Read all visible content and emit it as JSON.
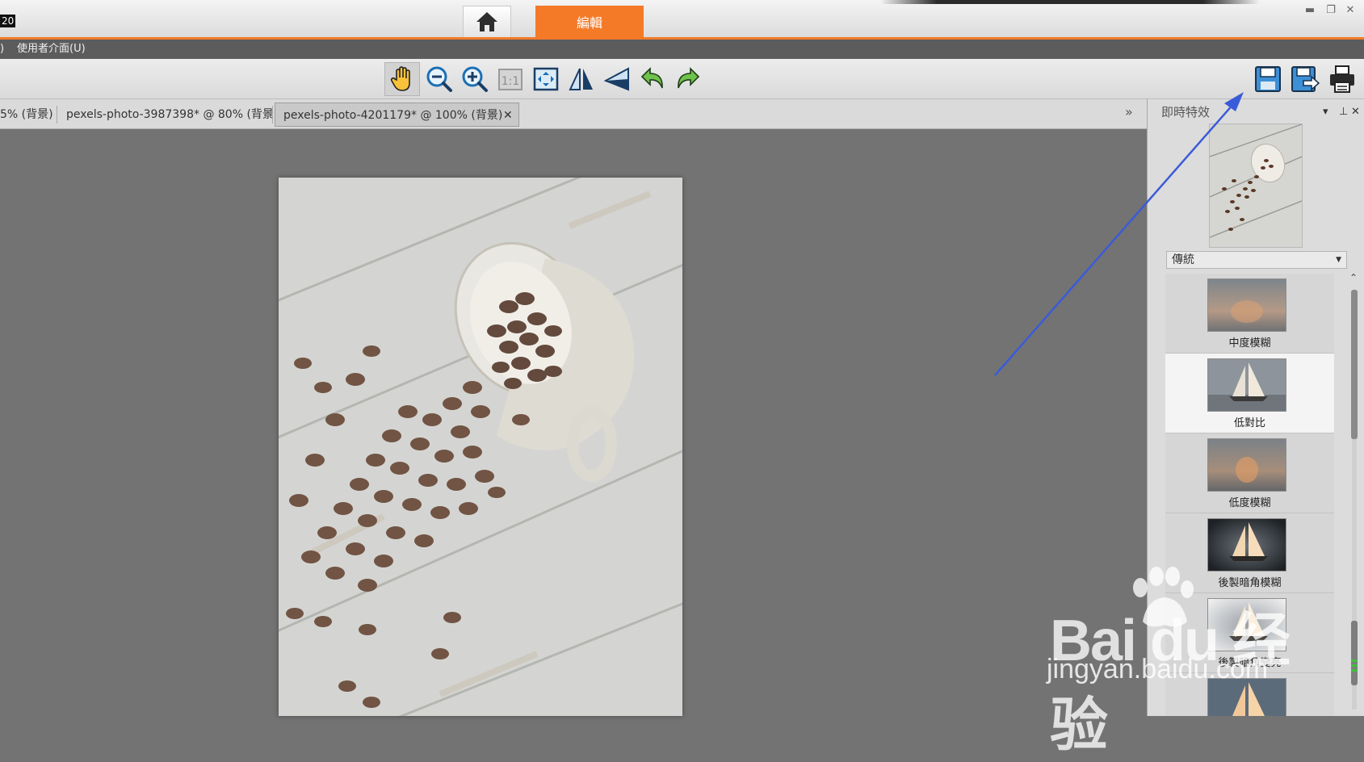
{
  "titlebar": {
    "version_badge": "20",
    "edit_tab_label": "編輯",
    "home_icon": "home-icon",
    "window_controls": [
      "minimize-icon",
      "restore-icon",
      "close-icon"
    ]
  },
  "menubar": {
    "items": [
      ")",
      "使用者介面(U)"
    ]
  },
  "toolbar": {
    "tools": [
      "hand-icon",
      "zoom-out-icon",
      "zoom-in-icon",
      "actual-size-icon",
      "fit-to-window-icon",
      "flip-horizontal-icon",
      "flip-vertical-icon",
      "undo-icon",
      "redo-icon"
    ],
    "actual_size_text": "1:1",
    "right_tools": [
      "save-icon",
      "save-as-icon",
      "print-icon"
    ]
  },
  "doc_tabs": [
    {
      "label": "5% (背景)"
    },
    {
      "label": "pexels-photo-3987398* @  80% (背景)"
    },
    {
      "label": "pexels-photo-4201179* @ 100% (背景)",
      "active": true
    }
  ],
  "doc_tab_close": "✕",
  "doc_tabs_more": "»",
  "panel": {
    "title": "即時特效",
    "header_controls": [
      "▾",
      "⊥",
      "✕"
    ],
    "select_value": "傳統",
    "effects": [
      {
        "label": "中度模糊",
        "style": "blur"
      },
      {
        "label": "低對比",
        "style": "lowcontrast",
        "selected": true
      },
      {
        "label": "低度模糊",
        "style": "blur"
      },
      {
        "label": "後製暗角模糊",
        "style": "vignette"
      },
      {
        "label": "後製暗角變亮",
        "style": "bright"
      },
      {
        "label": "",
        "style": "normal"
      }
    ]
  },
  "watermark": {
    "main": "Bai du 经验",
    "sub": "jingyan.baidu.com"
  },
  "colors": {
    "accent": "#f47a28",
    "annotation_arrow": "#3a5bd9",
    "canvas_bg": "#737373"
  }
}
